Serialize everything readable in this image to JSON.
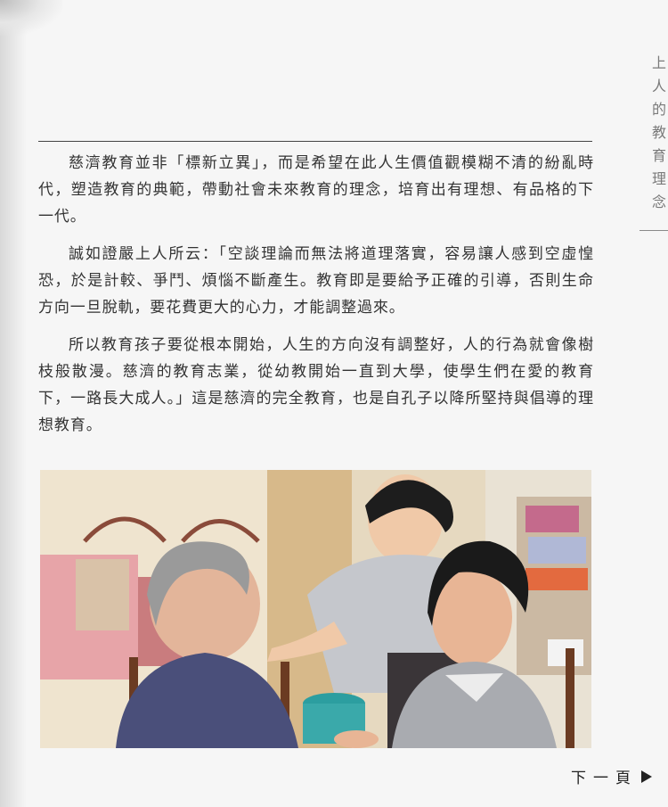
{
  "sidebar": {
    "section_title": "上人的教育理念"
  },
  "article": {
    "paragraphs": [
      "慈濟教育並非「標新立異」，而是希望在此人生價值觀模糊不清的紛亂時代，塑造教育的典範，帶動社會未來教育的理念，培育出有理想、有品格的下一代。",
      "誠如證嚴上人所云：「空談理論而無法將道理落實，容易讓人感到空虛惶恐，於是計較、爭鬥、煩惱不斷產生。教育即是要給予正確的引導，否則生命方向一旦脫軌，要花費更大的心力，才能調整過來。",
      "所以教育孩子要從根本開始，人生的方向沒有調整好，人的行為就會像樹枝般散漫。慈濟的教育志業，從幼教開始一直到大學，使學生們在愛的教育下，一路長大成人。」這是慈濟的完全教育，也是自孔子以降所堅持與倡導的理想教育。"
    ]
  },
  "navigation": {
    "next_page_label": "下一頁",
    "next_icon": "play-arrow-icon"
  },
  "colors": {
    "page_background": "#f6f6f6",
    "text": "#333333",
    "sidebar_text": "#7a7a7a",
    "uniform_gray": "#a9abb0"
  }
}
